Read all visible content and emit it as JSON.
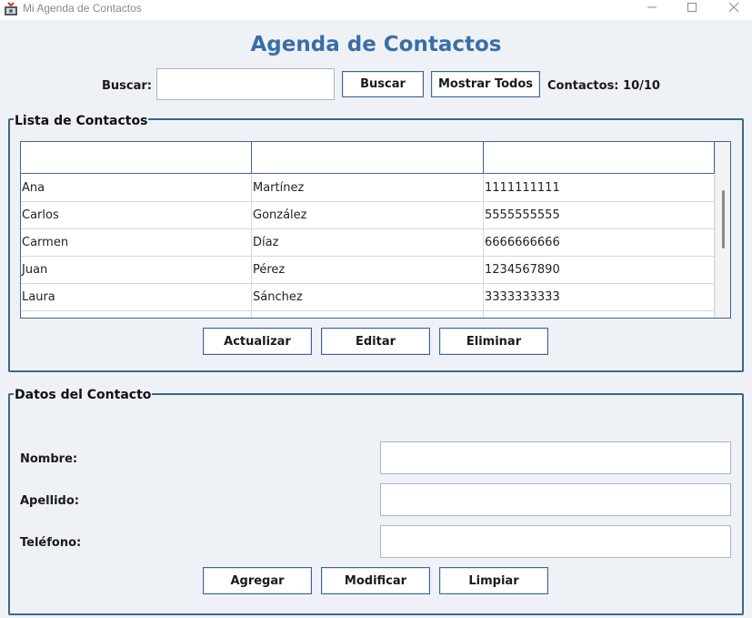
{
  "window": {
    "title": "Mi Agenda de Contactos"
  },
  "header": {
    "title": "Agenda de Contactos"
  },
  "search": {
    "label": "Buscar:",
    "value": "",
    "search_button": "Buscar",
    "show_all_button": "Mostrar Todos",
    "count_label": "Contactos: 10/10"
  },
  "contact_list": {
    "title": "Lista de Contactos",
    "columns": [
      "",
      "",
      ""
    ],
    "rows": [
      [
        "Ana",
        "Martínez",
        "1111111111"
      ],
      [
        "Carlos",
        "González",
        "5555555555"
      ],
      [
        "Carmen",
        "Díaz",
        "6666666666"
      ],
      [
        "Juan",
        "Pérez",
        "1234567890"
      ],
      [
        "Laura",
        "Sánchez",
        "3333333333"
      ]
    ],
    "buttons": {
      "refresh": "Actualizar",
      "edit": "Editar",
      "delete": "Eliminar"
    }
  },
  "contact_form": {
    "title": "Datos del Contacto",
    "name_label": "Nombre:",
    "name_value": "",
    "surname_label": "Apellido:",
    "surname_value": "",
    "phone_label": "Teléfono:",
    "phone_value": "",
    "buttons": {
      "add": "Agregar",
      "modify": "Modificar",
      "clear": "Limpiar"
    }
  },
  "colors": {
    "accent": "#3a6ea5",
    "border": "#3d6691",
    "background": "#eef2f7"
  },
  "icons": {
    "app": "java-app-icon",
    "minimize": "minimize-icon",
    "maximize": "maximize-icon",
    "close": "close-icon"
  }
}
